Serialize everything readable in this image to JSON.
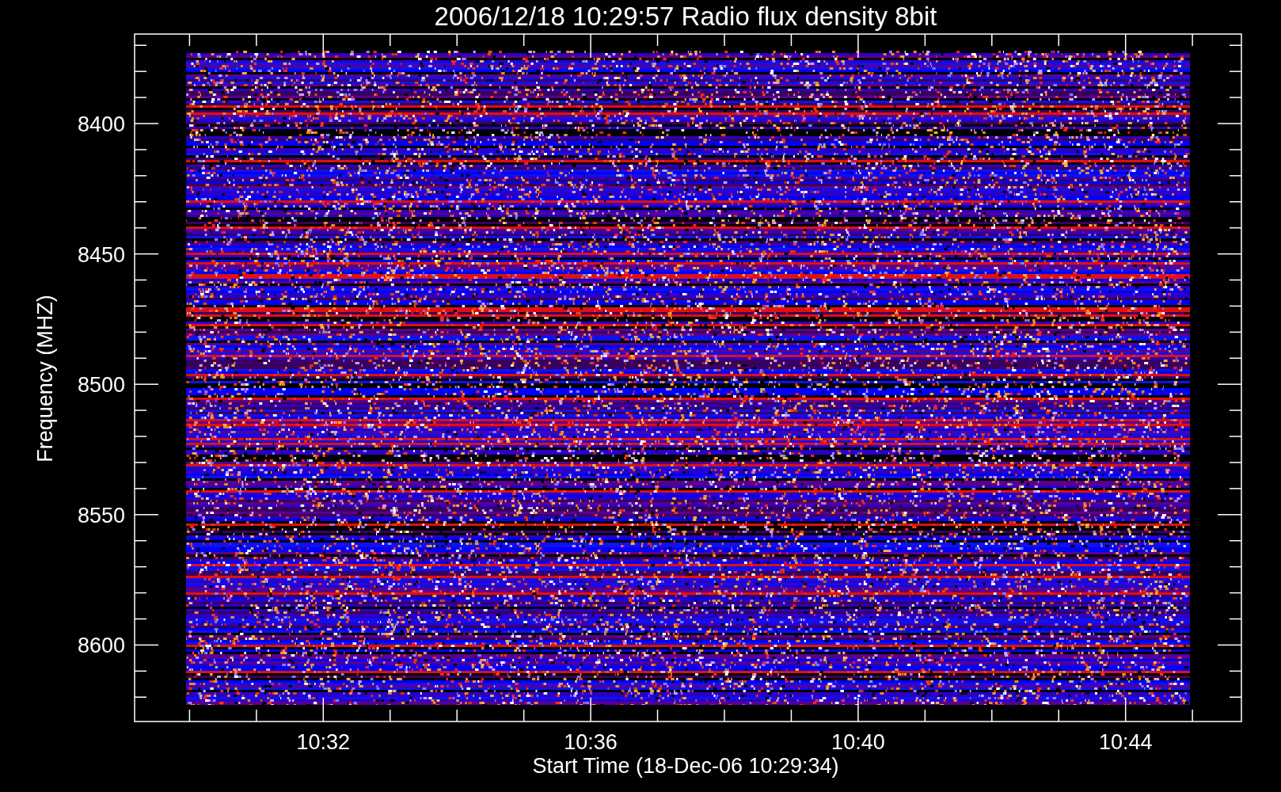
{
  "plot": {
    "title": "2006/12/18 10:29:57 Radio flux density 8bit",
    "y_axis": {
      "label": "Frequency (MHZ)",
      "tick_labels": [
        "8400",
        "8450",
        "8500",
        "8550",
        "8600"
      ]
    },
    "x_axis": {
      "label": "Start Time (18-Dec-06 10:29:34)",
      "tick_labels": [
        "10:32",
        "10:36",
        "10:40",
        "10:44"
      ]
    }
  }
}
